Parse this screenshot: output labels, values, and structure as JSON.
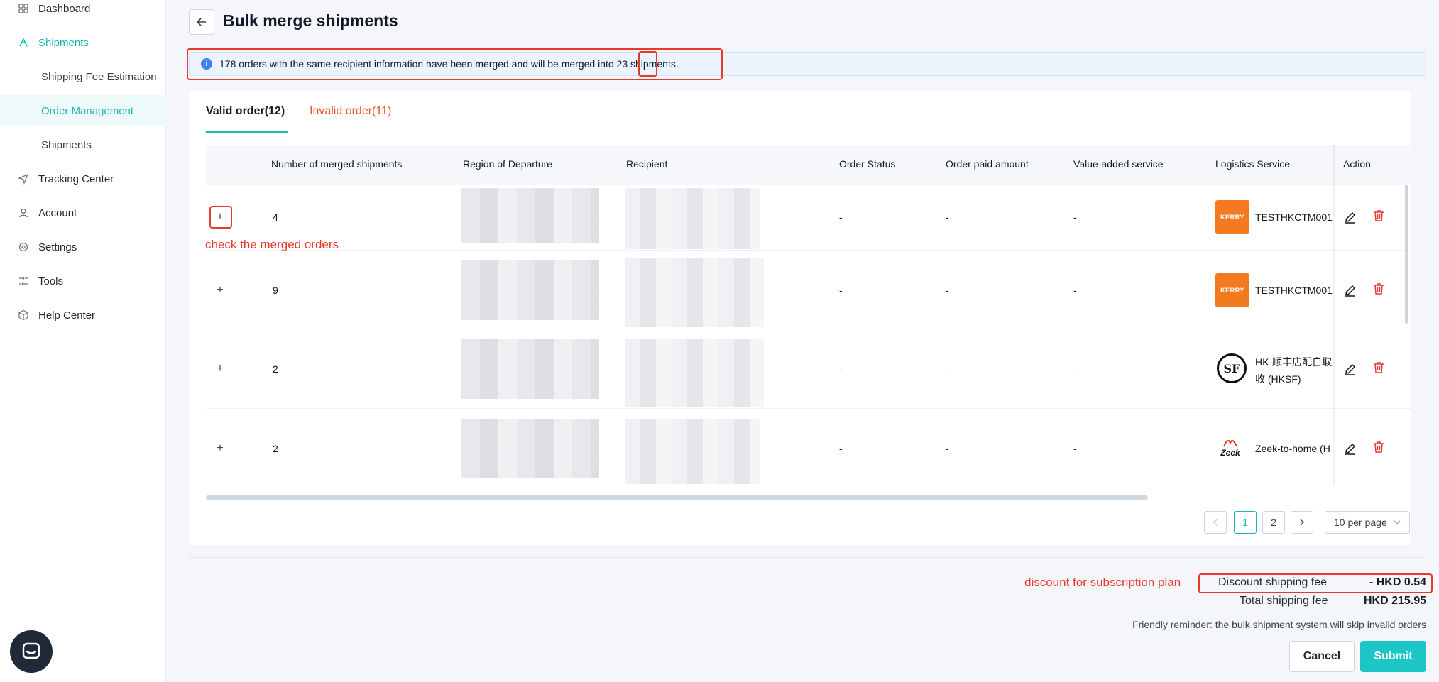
{
  "sidebar": {
    "items": [
      {
        "label": "Dashboard",
        "icon": "dashboard-icon"
      },
      {
        "label": "Shipments",
        "icon": "shipments-icon"
      },
      {
        "label": "Shipping Fee Estimation"
      },
      {
        "label": "Order Management"
      },
      {
        "label": "Shipments"
      },
      {
        "label": "Tracking Center",
        "icon": "send-icon"
      },
      {
        "label": "Account",
        "icon": "user-icon"
      },
      {
        "label": "Settings",
        "icon": "settings-icon"
      },
      {
        "label": "Tools",
        "icon": "tools-icon"
      },
      {
        "label": "Help Center",
        "icon": "help-box-icon"
      }
    ]
  },
  "header": {
    "title": "Bulk merge shipments"
  },
  "alert": {
    "text_before": "178 orders with the same recipient information have been merged and will be merged into ",
    "highlight": "23",
    "text_after": " shipments."
  },
  "tabs": {
    "valid": "Valid order(12)",
    "invalid": "Invalid order(11)"
  },
  "table": {
    "columns": [
      "Number of merged shipments",
      "Region of Departure",
      "Recipient",
      "Order Status",
      "Order paid amount",
      "Value-added service",
      "Logistics Service",
      "Action"
    ],
    "rows": [
      {
        "expand": "+",
        "merged": "4",
        "status": "-",
        "paid": "-",
        "vas": "-",
        "logistics": "TESTHKCTM001",
        "logo": "kerry-logistics-logo",
        "logo_text": "KERRY"
      },
      {
        "expand": "+",
        "merged": "9",
        "status": "-",
        "paid": "-",
        "vas": "-",
        "logistics": "TESTHKCTM001",
        "logo": "kerry-logistics-logo",
        "logo_text": "KERRY"
      },
      {
        "expand": "+",
        "merged": "2",
        "status": "-",
        "paid": "-",
        "vas": "-",
        "logistics_line1": "HK-顺丰店配自取-",
        "logistics_line2": "收 (HKSF)",
        "logo": "sf-express-logo",
        "logo_text": "SF"
      },
      {
        "expand": "+",
        "merged": "2",
        "status": "-",
        "paid": "-",
        "vas": "-",
        "logistics": "Zeek-to-home (H",
        "logo": "zeek-logo",
        "logo_text": "Zeek"
      }
    ]
  },
  "annotations": {
    "expand_hint": "check the merged orders",
    "discount_hint": "discount for subscription plan"
  },
  "pagination": {
    "pages": [
      "1",
      "2"
    ],
    "current": "1",
    "per_page": "10 per page"
  },
  "fees": {
    "discount_label": "Discount shipping fee",
    "discount_value": "- HKD 0.54",
    "total_label": "Total shipping fee",
    "total_value": "HKD 215.95"
  },
  "reminder": "Friendly reminder: the bulk shipment system will skip invalid orders",
  "buttons": {
    "cancel": "Cancel",
    "submit": "Submit"
  },
  "colors": {
    "accent": "#1cb6b6",
    "annotation": "#e8392b",
    "invalid_tab": "#e8572b"
  }
}
